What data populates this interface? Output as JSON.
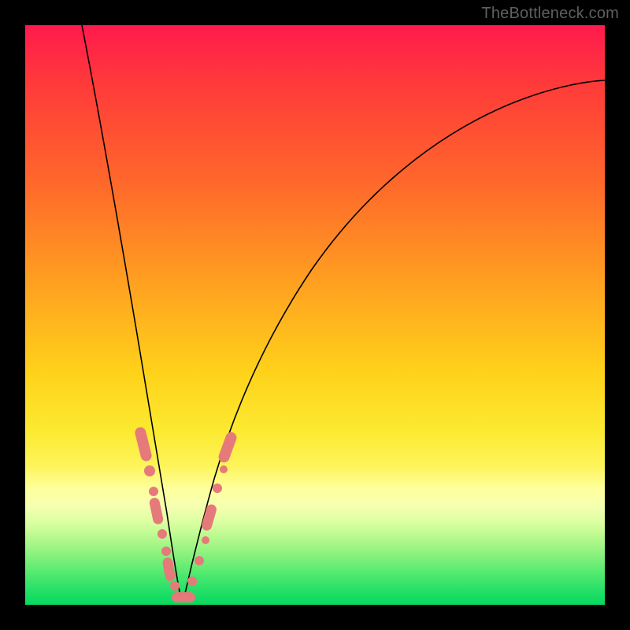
{
  "watermark": "TheBottleneck.com",
  "colors": {
    "frame": "#000000",
    "marker": "#e67a7a",
    "curve": "#000000"
  },
  "chart_data": {
    "type": "line",
    "title": "",
    "xlabel": "",
    "ylabel": "",
    "xlim": [
      0,
      100
    ],
    "ylim": [
      0,
      100
    ],
    "grid": false,
    "legend": false,
    "series": [
      {
        "name": "left-branch",
        "x": [
          10,
          12,
          14,
          16,
          18,
          20,
          21,
          22,
          23,
          24,
          25,
          26
        ],
        "y": [
          100,
          82,
          66,
          51,
          38,
          27,
          22,
          17,
          12,
          8,
          4,
          1
        ]
      },
      {
        "name": "right-branch",
        "x": [
          27,
          29,
          31,
          34,
          38,
          44,
          52,
          62,
          74,
          88,
          100
        ],
        "y": [
          1,
          7,
          15,
          25,
          37,
          50,
          62,
          72,
          80,
          86,
          89
        ]
      }
    ],
    "markers": {
      "name": "highlighted-region",
      "note": "salmon capsule/dot markers near the trough",
      "points_left": [
        {
          "x": 20.2,
          "y": 28.5
        },
        {
          "x": 21.0,
          "y": 24.0
        },
        {
          "x": 22.0,
          "y": 18.0
        },
        {
          "x": 22.6,
          "y": 14.0
        },
        {
          "x": 23.3,
          "y": 10.0
        },
        {
          "x": 24.3,
          "y": 6.0
        },
        {
          "x": 25.3,
          "y": 3.0
        }
      ],
      "points_right": [
        {
          "x": 27.5,
          "y": 3.0
        },
        {
          "x": 28.8,
          "y": 7.0
        },
        {
          "x": 30.0,
          "y": 12.0
        },
        {
          "x": 31.2,
          "y": 17.0
        },
        {
          "x": 32.6,
          "y": 22.0
        },
        {
          "x": 34.0,
          "y": 27.0
        }
      ],
      "bottom_bar": {
        "x0": 25.5,
        "x1": 27.2,
        "y": 1.2
      }
    }
  }
}
